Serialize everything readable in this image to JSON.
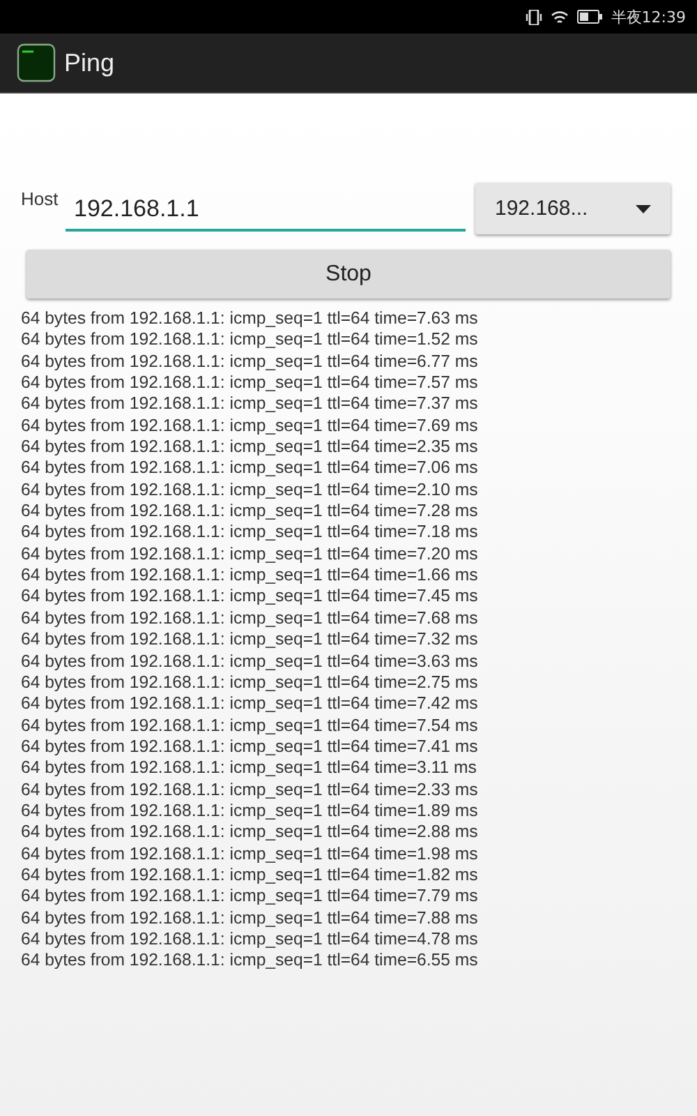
{
  "status_bar": {
    "time": "半夜12:39"
  },
  "app_bar": {
    "title": "Ping"
  },
  "host": {
    "label": "Host",
    "value": "192.168.1.1"
  },
  "dropdown": {
    "value": "192.168..."
  },
  "button": {
    "label": "Stop"
  },
  "log": [
    "64 bytes from 192.168.1.1: icmp_seq=1 ttl=64 time=7.63 ms",
    "64 bytes from 192.168.1.1: icmp_seq=1 ttl=64 time=1.52 ms",
    "64 bytes from 192.168.1.1: icmp_seq=1 ttl=64 time=6.77 ms",
    "64 bytes from 192.168.1.1: icmp_seq=1 ttl=64 time=7.57 ms",
    "64 bytes from 192.168.1.1: icmp_seq=1 ttl=64 time=7.37 ms",
    "64 bytes from 192.168.1.1: icmp_seq=1 ttl=64 time=7.69 ms",
    "64 bytes from 192.168.1.1: icmp_seq=1 ttl=64 time=2.35 ms",
    "64 bytes from 192.168.1.1: icmp_seq=1 ttl=64 time=7.06 ms",
    "64 bytes from 192.168.1.1: icmp_seq=1 ttl=64 time=2.10 ms",
    "64 bytes from 192.168.1.1: icmp_seq=1 ttl=64 time=7.28 ms",
    "64 bytes from 192.168.1.1: icmp_seq=1 ttl=64 time=7.18 ms",
    "64 bytes from 192.168.1.1: icmp_seq=1 ttl=64 time=7.20 ms",
    "64 bytes from 192.168.1.1: icmp_seq=1 ttl=64 time=1.66 ms",
    "64 bytes from 192.168.1.1: icmp_seq=1 ttl=64 time=7.45 ms",
    "64 bytes from 192.168.1.1: icmp_seq=1 ttl=64 time=7.68 ms",
    "64 bytes from 192.168.1.1: icmp_seq=1 ttl=64 time=7.32 ms",
    "64 bytes from 192.168.1.1: icmp_seq=1 ttl=64 time=3.63 ms",
    "64 bytes from 192.168.1.1: icmp_seq=1 ttl=64 time=2.75 ms",
    "64 bytes from 192.168.1.1: icmp_seq=1 ttl=64 time=7.42 ms",
    "64 bytes from 192.168.1.1: icmp_seq=1 ttl=64 time=7.54 ms",
    "64 bytes from 192.168.1.1: icmp_seq=1 ttl=64 time=7.41 ms",
    "64 bytes from 192.168.1.1: icmp_seq=1 ttl=64 time=3.11 ms",
    "64 bytes from 192.168.1.1: icmp_seq=1 ttl=64 time=2.33 ms",
    "64 bytes from 192.168.1.1: icmp_seq=1 ttl=64 time=1.89 ms",
    "64 bytes from 192.168.1.1: icmp_seq=1 ttl=64 time=2.88 ms",
    "64 bytes from 192.168.1.1: icmp_seq=1 ttl=64 time=1.98 ms",
    "64 bytes from 192.168.1.1: icmp_seq=1 ttl=64 time=1.82 ms",
    "64 bytes from 192.168.1.1: icmp_seq=1 ttl=64 time=7.79 ms",
    "64 bytes from 192.168.1.1: icmp_seq=1 ttl=64 time=7.88 ms",
    "64 bytes from 192.168.1.1: icmp_seq=1 ttl=64 time=4.78 ms",
    "64 bytes from 192.168.1.1: icmp_seq=1 ttl=64 time=6.55 ms"
  ]
}
